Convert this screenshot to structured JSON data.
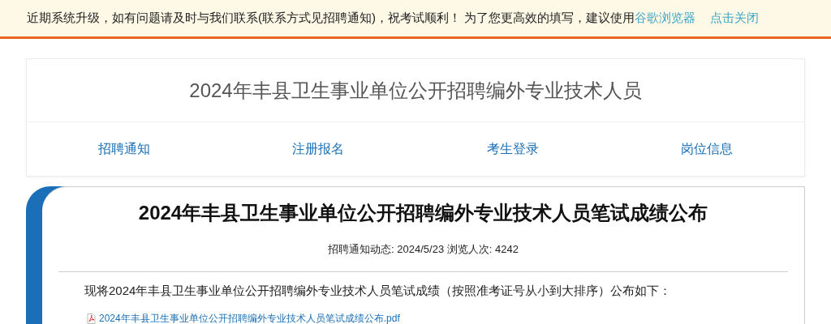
{
  "notice_bar": {
    "message": "近期系统升级，如有问题请及时与我们联系(联系方式见招聘通知)，祝考试顺利！ 为了您更高效的填写，建议使用",
    "browser_link": "谷歌浏览器",
    "close_link": "点击关闭"
  },
  "header": {
    "title": "2024年丰县卫生事业单位公开招聘编外专业技术人员"
  },
  "nav": [
    {
      "label": "招聘通知"
    },
    {
      "label": "注册报名"
    },
    {
      "label": "考生登录"
    },
    {
      "label": "岗位信息"
    }
  ],
  "article": {
    "title": "2024年丰县卫生事业单位公开招聘编外专业技术人员笔试成绩公布",
    "meta": "招聘通知动态: 2024/5/23 浏览人次: 4242",
    "intro": "现将2024年丰县卫生事业单位公开招聘编外专业技术人员笔试成绩（按照准考证号从小到大排序）公布如下：",
    "attachment": "2024年丰县卫生事业单位公开招聘编外专业技术人员笔试成绩公布.pdf"
  }
}
